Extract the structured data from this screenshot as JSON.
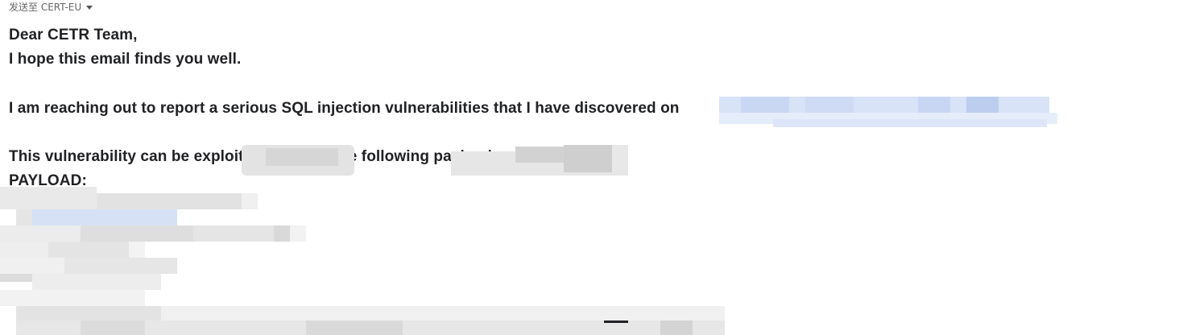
{
  "email": {
    "recipient_prefix": "发送至 CERT-EU",
    "greeting": "Dear CETR Team,",
    "opening": "I hope this email finds you well.",
    "report_line": "I am reaching out to report a serious SQL injection vulnerabilities that I have discovered on",
    "exploit_line": "This vulnerability can be exploited by using the following payload and",
    "payload_label": "PAYLOAD:"
  },
  "colors": {
    "text": "#202124",
    "meta_text": "#666666",
    "link": "#1a57c2",
    "redaction_gray": "#e0e0e0",
    "redaction_blue": "#d3def5"
  }
}
